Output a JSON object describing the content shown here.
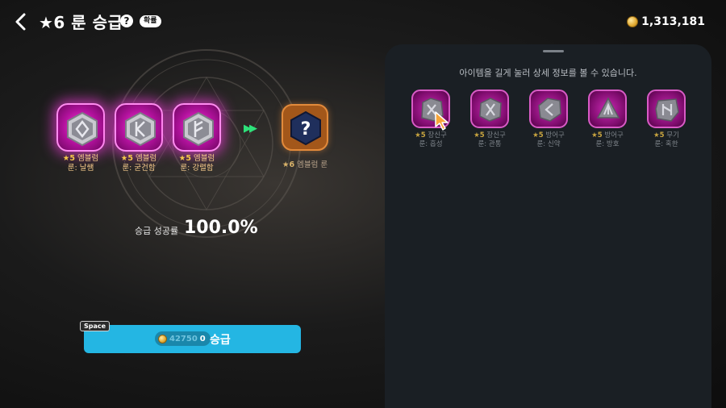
{
  "header": {
    "title": "★6 룬 승급",
    "help": "?",
    "prob_badge": "확률",
    "currency_amount": "1,313,181"
  },
  "materials": [
    {
      "star": "★5",
      "category": "엠블럼",
      "name": "룬: 날쌤"
    },
    {
      "star": "★5",
      "category": "엠블럼",
      "name": "룬: 굳건함"
    },
    {
      "star": "★5",
      "category": "엠블럼",
      "name": "룬: 강렬함"
    }
  ],
  "result": {
    "star": "★6",
    "label": "엠블럼 룬",
    "symbol": "?"
  },
  "success": {
    "caption": "승급 성공률",
    "value": "100.0%"
  },
  "upgrade": {
    "hotkey": "Space",
    "cost_required": "42750",
    "cost_have": "0",
    "label": "승급"
  },
  "inventory": {
    "hint": "아이템을 길게 눌러 상세 정보를 볼 수 있습니다.",
    "items": [
      {
        "star": "★5",
        "category": "장신구",
        "name": "룬: 흡성"
      },
      {
        "star": "★5",
        "category": "장신구",
        "name": "룬: 관통"
      },
      {
        "star": "★5",
        "category": "방어구",
        "name": "룬: 신약"
      },
      {
        "star": "★5",
        "category": "방어구",
        "name": "룬: 방호"
      },
      {
        "star": "★5",
        "category": "무기",
        "name": "룬: 혹한"
      }
    ]
  },
  "colors": {
    "rune_glow": "#ff3dde",
    "result_slot": "#a3571a",
    "upgrade_button": "#24b6e3",
    "panel": "#1a1f24",
    "arrow": "#2ee27a"
  },
  "icons": [
    "back-arrow-icon",
    "help-icon",
    "coin-icon",
    "rune-gem-icon",
    "fast-forward-icon",
    "question-hex-icon",
    "rune-stone-icon",
    "hand-cursor-icon"
  ]
}
